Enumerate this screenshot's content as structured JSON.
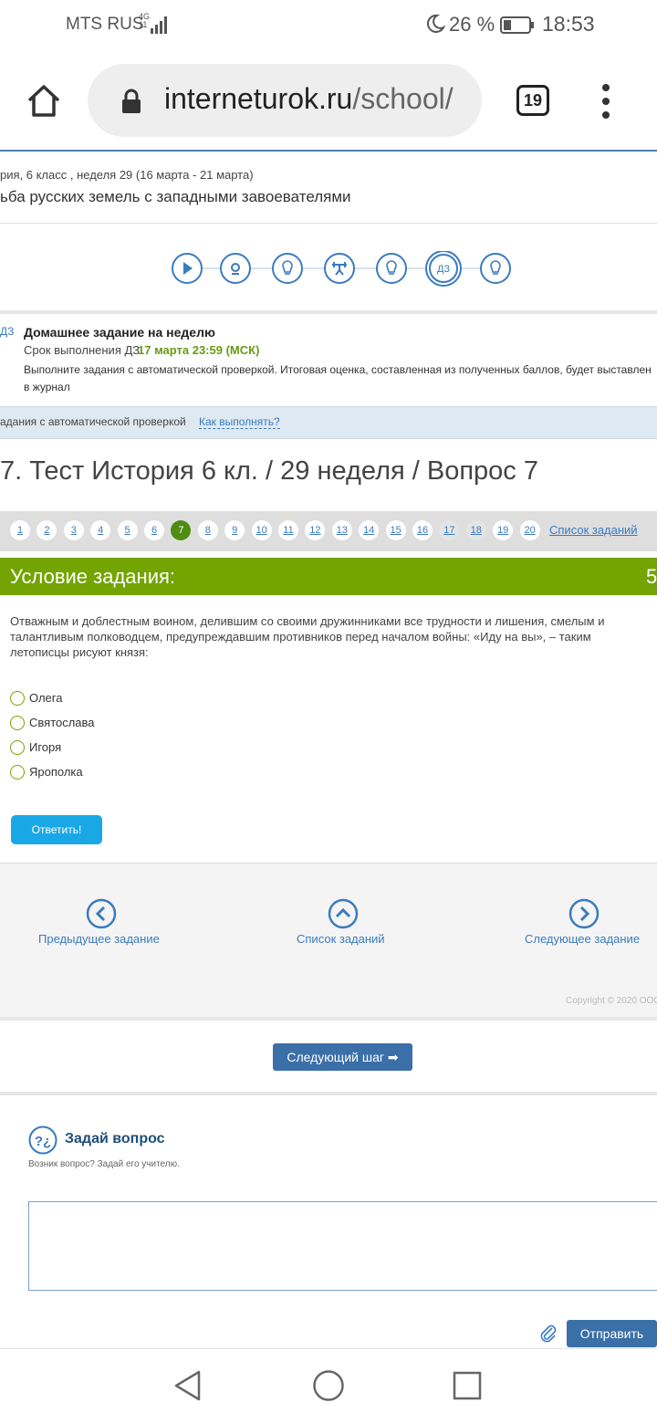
{
  "status_bar": {
    "carrier": "MTS RUS",
    "network": "4G",
    "network_sub": "11",
    "battery_percent": "26 %",
    "time": "18:53"
  },
  "browser": {
    "url_domain": "interneturok.ru",
    "url_path": "/school/",
    "tab_count": "19"
  },
  "lesson": {
    "breadcrumb": "рия, 6 класс , неделя 29 (16 марта - 21 марта)",
    "title": "ьба русских земель с западными завоевателями",
    "steps": [
      "play-icon",
      "webcam-icon",
      "lightbulb-icon",
      "exercise-icon",
      "lightbulb-icon",
      "homework-icon",
      "lightbulb-icon"
    ],
    "active_step_label": "ДЗ"
  },
  "homework": {
    "badge": "ДЗ",
    "title": "Домашнее задание на неделю",
    "deadline_label": "Срок выполнения ДЗ:",
    "deadline_value": "17 марта 23:59 (МСК)",
    "description_line1": "Выполните задания с автоматической проверкой. Итоговая оценка, составленная из полученных баллов, будет выставлен",
    "description_line2": "в журнал"
  },
  "auto_check": {
    "text": "адания с автоматической проверкой",
    "link": "Как выполнять?"
  },
  "test": {
    "title": "7. Тест История 6 кл. / 29 неделя / Вопрос 7",
    "pages": [
      "1",
      "2",
      "3",
      "4",
      "5",
      "6",
      "7",
      "8",
      "9",
      "10",
      "11",
      "12",
      "13",
      "14",
      "15",
      "16",
      "17",
      "18",
      "19",
      "20"
    ],
    "active_page": "7",
    "list_link": "Список заданий"
  },
  "condition": {
    "header": "Условие задания:",
    "points": "5",
    "question": "Отважным и доблестным воином, делившим со своими дружинниками все трудности и лишения, смелым и талантливым полководцем, предупреждавшим противников перед началом войны: «Иду на вы», – таким летописцы рисуют князя:",
    "options": [
      "Олега",
      "Святослава",
      "Игоря",
      "Ярополка"
    ],
    "answer_button": "Ответить!"
  },
  "navigation": {
    "prev": "Предыдущее задание",
    "list": "Список заданий",
    "next": "Следующее задание",
    "copyright": "Copyright © 2020 ООО"
  },
  "next_step_button": "Следующий шаг ➡",
  "ask": {
    "title": "Задай вопрос",
    "subtitle": "Возник вопрос? Задай его учителю.",
    "input_value": "",
    "send_button": "Отправить"
  },
  "colors": {
    "accent_green": "#73a400",
    "link_blue": "#3a7bbf",
    "button_blue": "#3a6fa8",
    "answer_cyan": "#19a8e5"
  }
}
